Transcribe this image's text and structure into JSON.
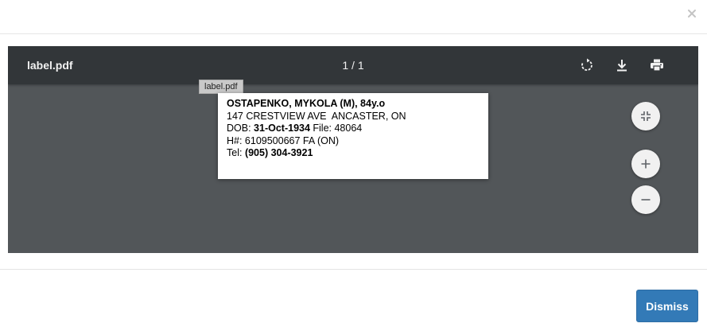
{
  "modal": {
    "close_icon": "close-icon",
    "dismiss_label": "Dismiss",
    "dismiss_color": "#337ab7"
  },
  "viewer": {
    "title": "label.pdf",
    "page_indicator": "1 / 1",
    "tooltip": "label.pdf",
    "icons": [
      "rotate-icon",
      "download-icon",
      "print-icon",
      "fit-page-icon",
      "zoom-in-icon",
      "zoom-out-icon"
    ],
    "colors": {
      "toolbar": "#323639",
      "background": "#525659"
    }
  },
  "label": {
    "line1": "OSTAPENKO, MYKOLA (M), 84y.o",
    "line2": "147 CRESTVIEW AVE  ANCASTER, ON",
    "dob_prefix": "DOB: ",
    "dob_value": "31-Oct-1934",
    "file_text": " File: 48064",
    "line4": "H#: 6109500667 FA (ON)",
    "tel_prefix": "Tel: ",
    "tel_value": "(905) 304-3921"
  }
}
